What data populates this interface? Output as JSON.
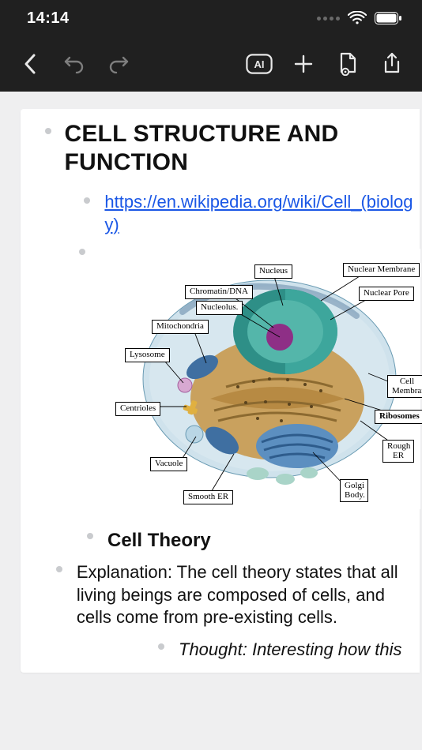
{
  "status": {
    "time": "14:14"
  },
  "doc": {
    "title": "CELL STRUCTURE AND FUNCTION",
    "link": "https://en.wikipedia.org/wiki/Cell_(biology)",
    "section": "Cell Theory",
    "explanation": "Explanation: The cell theory states that all living beings are composed of cells, and cells come from pre-existing cells.",
    "thought": "Thought: Interesting how this"
  },
  "diagram": {
    "labels": {
      "nucleus": "Nucleus",
      "nuclear_membrane": "Nuclear Membrane",
      "chromatin": "Chromatin/DNA",
      "nuclear_pore": "Nuclear Pore",
      "nucleolus": "Nucleolus.",
      "mitochondria": "Mitochondria",
      "lysosome": "Lysosome",
      "centrioles": "Centrioles",
      "cell_membrane": "Cell\nMembrane",
      "ribosomes": "Ribosomes",
      "rough_er": "Rough\nER",
      "vacuole": "Vacuole",
      "golgi": "Golgi\nBody.",
      "smooth_er": "Smooth ER"
    }
  }
}
